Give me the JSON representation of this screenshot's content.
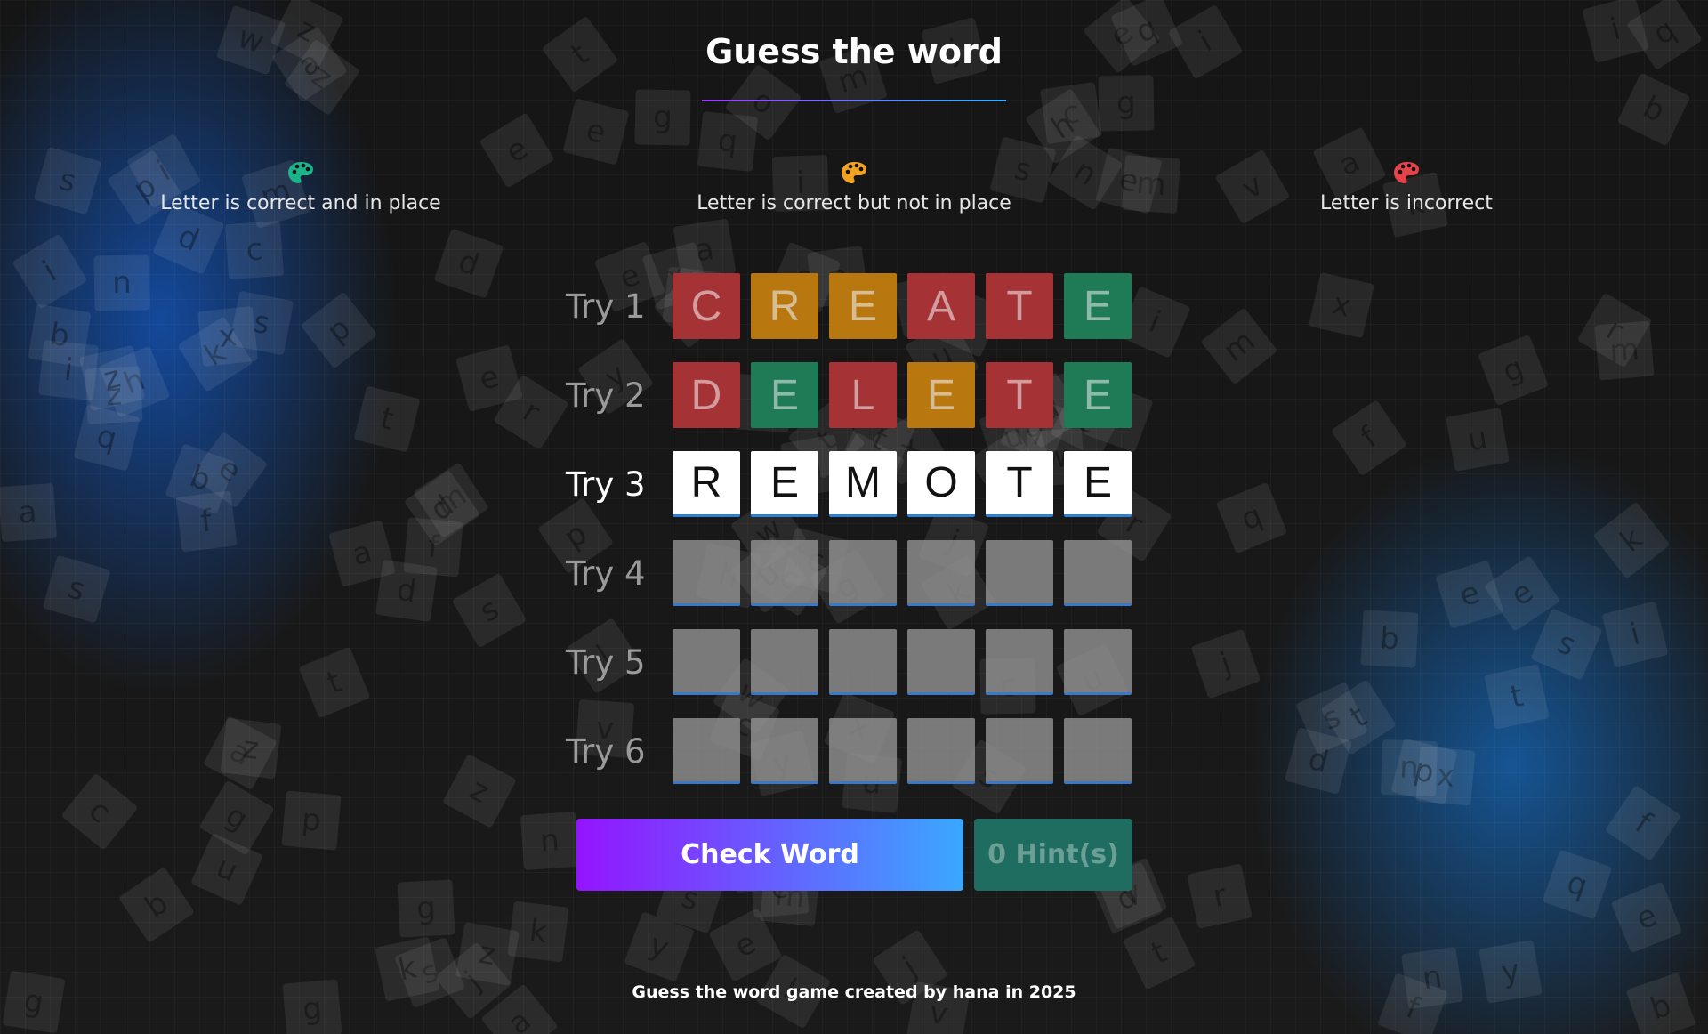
{
  "header": {
    "title": "Guess the word"
  },
  "legend": [
    {
      "label": "Letter is correct and in place",
      "icon": "palette-icon",
      "color": "#1bb38a"
    },
    {
      "label": "Letter is correct but not in place",
      "icon": "palette-icon",
      "color": "#f2a221"
    },
    {
      "label": "Letter is incorrect",
      "icon": "palette-icon",
      "color": "#e4434a"
    }
  ],
  "colors": {
    "correct": "#1f7a56",
    "misplaced": "#b8780f",
    "wrong": "#a53235",
    "empty": "#969696",
    "check_gradient": [
      "#9414ff",
      "#3aa8ff"
    ],
    "hint": "#1f6d60"
  },
  "board": {
    "rows": [
      {
        "label": "Try 1",
        "state": "submitted",
        "cells": [
          {
            "letter": "C",
            "status": "wrong"
          },
          {
            "letter": "R",
            "status": "misplaced"
          },
          {
            "letter": "E",
            "status": "misplaced"
          },
          {
            "letter": "A",
            "status": "wrong"
          },
          {
            "letter": "T",
            "status": "wrong"
          },
          {
            "letter": "E",
            "status": "correct"
          }
        ]
      },
      {
        "label": "Try 2",
        "state": "submitted",
        "cells": [
          {
            "letter": "D",
            "status": "wrong"
          },
          {
            "letter": "E",
            "status": "correct"
          },
          {
            "letter": "L",
            "status": "wrong"
          },
          {
            "letter": "E",
            "status": "misplaced"
          },
          {
            "letter": "T",
            "status": "wrong"
          },
          {
            "letter": "E",
            "status": "correct"
          }
        ]
      },
      {
        "label": "Try 3",
        "state": "active",
        "cells": [
          {
            "letter": "R",
            "status": "current"
          },
          {
            "letter": "E",
            "status": "current"
          },
          {
            "letter": "M",
            "status": "current"
          },
          {
            "letter": "O",
            "status": "current"
          },
          {
            "letter": "T",
            "status": "current"
          },
          {
            "letter": "E",
            "status": "current"
          }
        ]
      },
      {
        "label": "Try 4",
        "state": "empty",
        "cells": [
          {
            "letter": "",
            "status": "empty"
          },
          {
            "letter": "",
            "status": "empty"
          },
          {
            "letter": "",
            "status": "empty"
          },
          {
            "letter": "",
            "status": "empty"
          },
          {
            "letter": "",
            "status": "empty"
          },
          {
            "letter": "",
            "status": "empty"
          }
        ]
      },
      {
        "label": "Try 5",
        "state": "empty",
        "cells": [
          {
            "letter": "",
            "status": "empty"
          },
          {
            "letter": "",
            "status": "empty"
          },
          {
            "letter": "",
            "status": "empty"
          },
          {
            "letter": "",
            "status": "empty"
          },
          {
            "letter": "",
            "status": "empty"
          },
          {
            "letter": "",
            "status": "empty"
          }
        ]
      },
      {
        "label": "Try 6",
        "state": "empty",
        "cells": [
          {
            "letter": "",
            "status": "empty"
          },
          {
            "letter": "",
            "status": "empty"
          },
          {
            "letter": "",
            "status": "empty"
          },
          {
            "letter": "",
            "status": "empty"
          },
          {
            "letter": "",
            "status": "empty"
          },
          {
            "letter": "",
            "status": "empty"
          }
        ]
      }
    ]
  },
  "actions": {
    "check_label": "Check Word",
    "hint_label": "0 Hint(s)"
  },
  "footer": {
    "text": "Guess the word game created by hana in 2025"
  }
}
